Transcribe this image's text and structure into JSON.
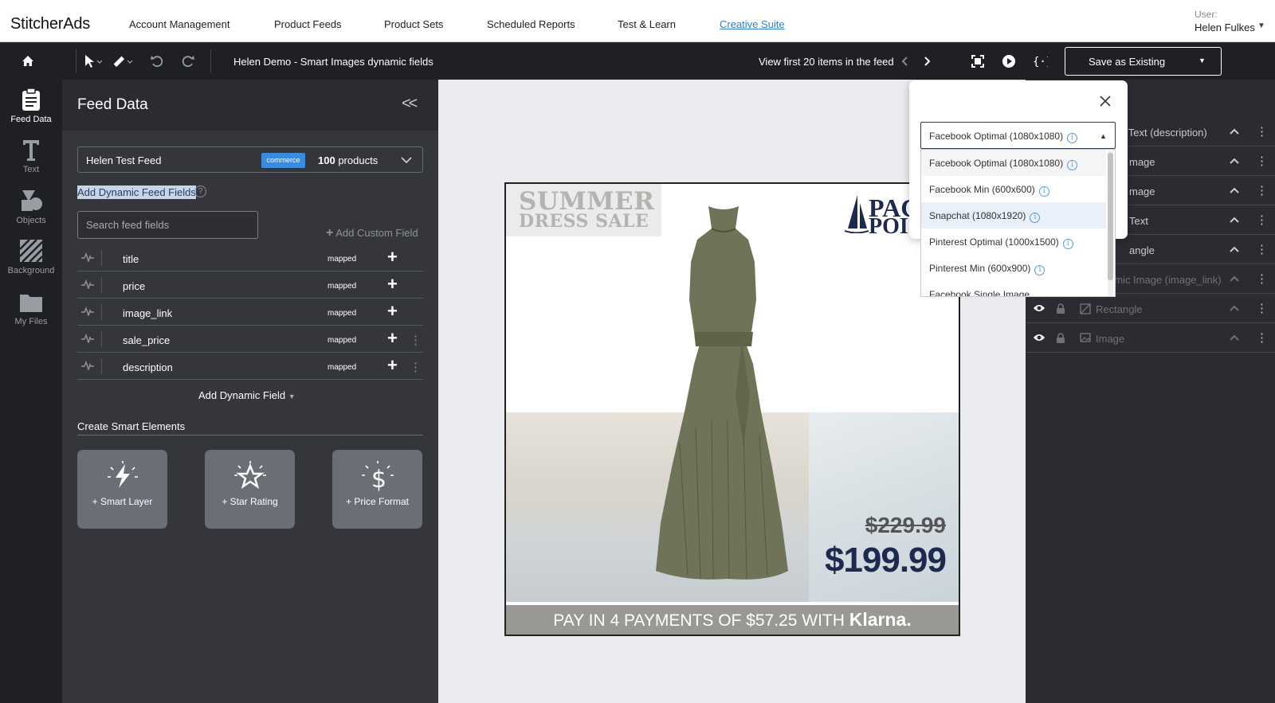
{
  "nav": {
    "brand": "StitcherAds",
    "links": [
      "Account Management",
      "Product Feeds",
      "Product Sets",
      "Scheduled Reports",
      "Test & Learn",
      "Creative Suite"
    ],
    "user_label": "User:",
    "user_name": "Helen Fulkes"
  },
  "toolbar": {
    "title": "Helen Demo - Smart Images dynamic fields",
    "view_label": "View first 20 items in the feed",
    "save_label": "Save as Existing"
  },
  "rail": {
    "items": [
      "Feed Data",
      "Text",
      "Objects",
      "Background",
      "My Files"
    ]
  },
  "panel": {
    "title": "Feed Data",
    "feed_name": "Helen Test Feed",
    "feed_badge": "commerce",
    "product_count": "100",
    "product_suffix": "products",
    "section_label": "Add Dynamic Feed Fields",
    "search_placeholder": "Search feed fields",
    "add_custom": "Add Custom Field",
    "fields": [
      {
        "name": "title",
        "status": "mapped"
      },
      {
        "name": "price",
        "status": "mapped"
      },
      {
        "name": "image_link",
        "status": "mapped"
      },
      {
        "name": "sale_price",
        "status": "mapped"
      },
      {
        "name": "description",
        "status": "mapped"
      }
    ],
    "add_dynamic": "Add Dynamic Field",
    "smart_label": "Create Smart Elements",
    "smart_cards": [
      "+ Smart Layer",
      "+ Star Rating",
      "+ Price Format"
    ]
  },
  "ad": {
    "headline1": "SUMMER",
    "headline2": "DRESS SALE",
    "logo1": "PACI",
    "logo2": "POI",
    "old_price": "$229.99",
    "new_price": "$199.99",
    "banner": "PAY IN 4 PAYMENTS OF $57.25 WITH",
    "banner_brand": "Klarna."
  },
  "layers": [
    {
      "name": "ic Text (description)",
      "dim": false
    },
    {
      "name": "mage",
      "dim": false
    },
    {
      "name": "mage",
      "dim": false
    },
    {
      "name": "Text",
      "dim": false
    },
    {
      "name": "angle",
      "dim": false
    },
    {
      "name": "amic Image (image_link)",
      "dim": true
    },
    {
      "name": "Rectangle",
      "dim": true
    },
    {
      "name": "Image",
      "dim": true
    }
  ],
  "size_picker": {
    "selected": "Facebook Optimal (1080x1080)",
    "options": [
      "Facebook Optimal (1080x1080)",
      "Facebook Min (600x600)",
      "Snapchat (1080x1920)",
      "Pinterest Optimal (1000x1500)",
      "Pinterest Min (600x900)",
      "Facebook Single Image"
    ]
  },
  "colors": {
    "accent": "#2f80c8",
    "badge": "#3a8bde",
    "brand_navy": "#1d2a4d"
  }
}
